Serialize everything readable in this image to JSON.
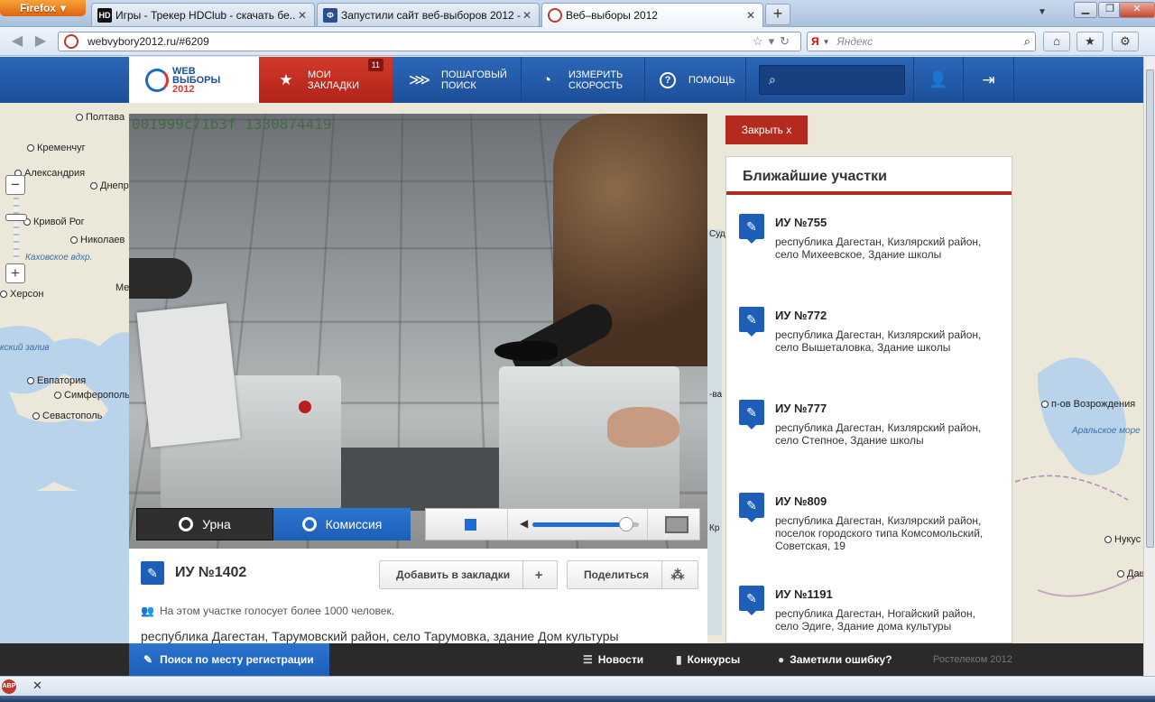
{
  "browser": {
    "app_button": "Firefox",
    "tabs": [
      {
        "favicon": "HD",
        "title": "Игры - Трекер HDClub - скачать бе..."
      },
      {
        "favicon": "Ф",
        "title": "Запустили сайт веб-выборов 2012 -..."
      },
      {
        "favicon": "",
        "title": "Веб–выборы 2012"
      }
    ],
    "url": "webvybory2012.ru/#6209",
    "search_engine": "Я",
    "search_placeholder": "Яндекс"
  },
  "site": {
    "logo_line1": "WEB",
    "logo_line2": "ВЫБОРЫ",
    "logo_line3": "2012",
    "nav": {
      "bookmarks_label_1": "МОИ",
      "bookmarks_label_2": "ЗАКЛАДКИ",
      "bookmarks_count": "11",
      "step_search_1": "ПОШАГОВЫЙ",
      "step_search_2": "ПОИСК",
      "speed_1": "ИЗМЕРИТЬ",
      "speed_2": "СКОРОСТЬ",
      "help": "ПОМОЩЬ"
    }
  },
  "map": {
    "cities": [
      "Полтава",
      "Кременчуг",
      "Александрия",
      "Днепр",
      "Кривой Рог",
      "Николаев",
      "Херсон",
      "Евпатория",
      "Симферополь",
      "Севастополь",
      "п-ов Возрождения",
      "Нукус",
      "Даш"
    ],
    "water": [
      "Каховское вдхр.",
      "кский залив",
      "Аральское море"
    ],
    "fragments": [
      "Ме",
      "-ва",
      "Кр",
      "Суд"
    ]
  },
  "video": {
    "overlay_id": "001999c71b3f 1330874419",
    "camera_urn": "Урна",
    "camera_commission": "Комиссия",
    "volume_level": 0.88
  },
  "station": {
    "title": "ИУ №1402",
    "add_bookmark": "Добавить в закладки",
    "share": "Поделиться",
    "voters_note": "На этом участке голосует более 1000 человек.",
    "address": "республика Дагестан, Тарумовский район, село Тарумовка, здание Дом культуры"
  },
  "nearest": {
    "close_label": "Закрыть  x",
    "title": "Ближайшие участки",
    "items": [
      {
        "name": "ИУ №755",
        "address": "республика Дагестан, Кизлярский район, село Михеевское, Здание школы"
      },
      {
        "name": "ИУ №772",
        "address": "республика Дагестан, Кизлярский район, село Вышеталовка, Здание школы"
      },
      {
        "name": "ИУ №777",
        "address": "республика Дагестан, Кизлярский район, село Степное, Здание школы"
      },
      {
        "name": "ИУ №809",
        "address": "республика Дагестан, Кизлярский район, поселок городского типа Комсомольский, Советская, 19"
      },
      {
        "name": "ИУ №1191",
        "address": "республика Дагестан, Ногайский район, село Эдиге, Здание дома культуры"
      }
    ]
  },
  "footer": {
    "reg_search": "Поиск по месту регистрации",
    "news": "Новости",
    "contests": "Конкурсы",
    "error": "Заметили ошибку?",
    "copyright": "Ростелеком 2012"
  },
  "status": {
    "abp": "ABP"
  },
  "colors": {
    "brand_blue": "#1d5fb8",
    "brand_red": "#b52a1f"
  }
}
